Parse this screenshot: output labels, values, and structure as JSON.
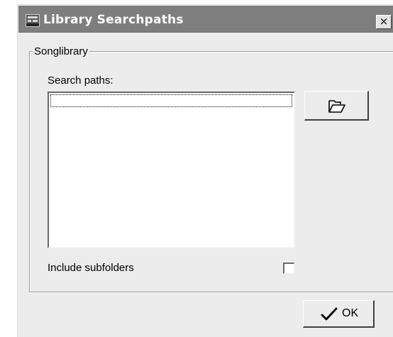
{
  "window": {
    "title": "Library Searchpaths",
    "close_label": "×"
  },
  "group": {
    "label": "Songlibrary",
    "search_paths_label": "Search paths:",
    "search_paths": [],
    "include_subfolders_label": "Include subfolders",
    "include_subfolders_checked": false
  },
  "buttons": {
    "browse_icon": "folder-open-icon",
    "ok_label": "OK",
    "ok_icon": "checkmark-icon"
  }
}
